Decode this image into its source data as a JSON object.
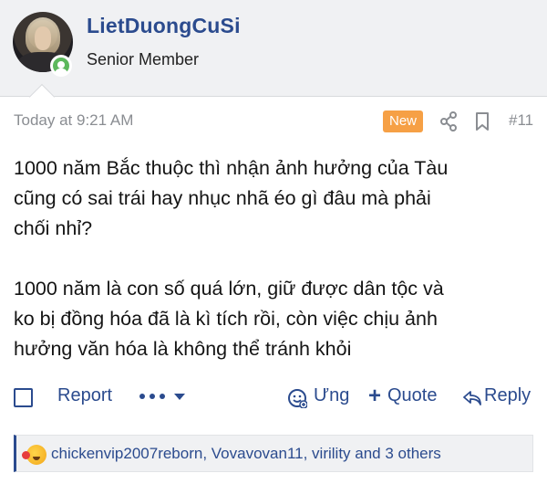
{
  "user": {
    "name": "LietDuongCuSi",
    "title": "Senior Member"
  },
  "post": {
    "time": "Today at 9:21 AM",
    "badge": "New",
    "number": "#11",
    "paragraphs": [
      [
        "1000 năm Bắc thuộc thì nhận ảnh hưởng của Tàu",
        "cũng có sai trái hay nhục nhã éo gì đâu mà phải",
        "chối nhỉ?"
      ],
      [
        "1000 năm là con số quá lớn, giữ được dân tộc và",
        "ko bị đồng hóa đã là kì tích rồi, còn việc chịu ảnh",
        "hưởng văn hóa là không thể tránh khỏi"
      ]
    ]
  },
  "actions": {
    "report": "Report",
    "react": "Ưng",
    "quote": "Quote",
    "reply": "Reply"
  },
  "reactions": {
    "summary": "chickenvip2007reborn, Vovavovan11, virility and 3 others"
  },
  "icons": {
    "share": "share-icon",
    "bookmark": "bookmark-icon",
    "more": "more-dots-icon",
    "react": "smiley-icon",
    "reply": "reply-arrow-icon",
    "reaction": "laughing-face-icon"
  },
  "colors": {
    "link": "#2b4b8e",
    "badge": "#f6a045",
    "online": "#5cb85c",
    "header_bg": "#f0f1f3"
  }
}
